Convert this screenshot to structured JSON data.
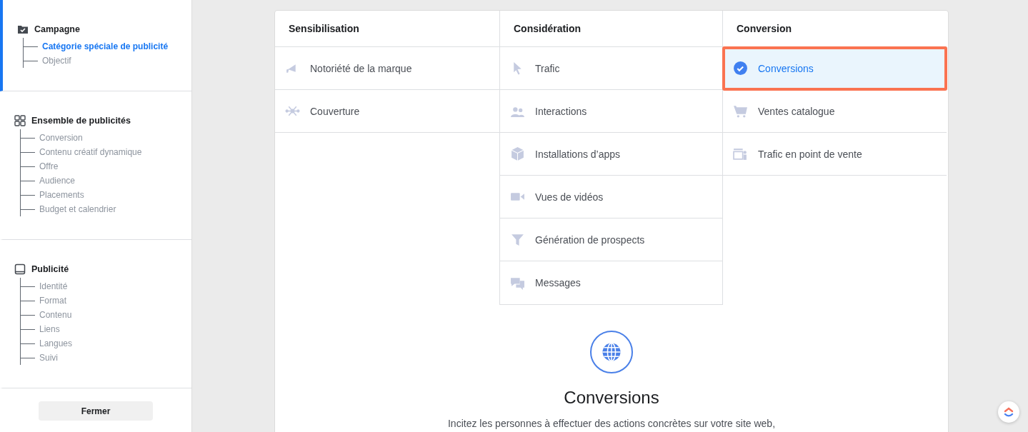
{
  "sidebar": {
    "sections": [
      {
        "title": "Campagne",
        "active": true,
        "items": [
          {
            "label": "Catégorie spéciale de publicité",
            "selected": true
          },
          {
            "label": "Objectif",
            "selected": false
          }
        ]
      },
      {
        "title": "Ensemble de publicités",
        "active": false,
        "items": [
          {
            "label": "Conversion",
            "selected": false
          },
          {
            "label": "Contenu créatif dynamique",
            "selected": false
          },
          {
            "label": "Offre",
            "selected": false
          },
          {
            "label": "Audience",
            "selected": false
          },
          {
            "label": "Placements",
            "selected": false
          },
          {
            "label": "Budget et calendrier",
            "selected": false
          }
        ]
      },
      {
        "title": "Publicité",
        "active": false,
        "items": [
          {
            "label": "Identité",
            "selected": false
          },
          {
            "label": "Format",
            "selected": false
          },
          {
            "label": "Contenu",
            "selected": false
          },
          {
            "label": "Liens",
            "selected": false
          },
          {
            "label": "Langues",
            "selected": false
          },
          {
            "label": "Suivi",
            "selected": false
          }
        ]
      }
    ],
    "close_button": "Fermer"
  },
  "objectives": {
    "columns": [
      {
        "heading": "Sensibilisation",
        "items": [
          {
            "label": "Notoriété de la marque",
            "selected": false
          },
          {
            "label": "Couverture",
            "selected": false
          }
        ]
      },
      {
        "heading": "Considération",
        "items": [
          {
            "label": "Trafic",
            "selected": false
          },
          {
            "label": "Interactions",
            "selected": false
          },
          {
            "label": "Installations d’apps",
            "selected": false
          },
          {
            "label": "Vues de vidéos",
            "selected": false
          },
          {
            "label": "Génération de prospects",
            "selected": false
          },
          {
            "label": "Messages",
            "selected": false
          }
        ]
      },
      {
        "heading": "Conversion",
        "items": [
          {
            "label": "Conversions",
            "selected": true
          },
          {
            "label": "Ventes catalogue",
            "selected": false
          },
          {
            "label": "Trafic en point de vente",
            "selected": false
          }
        ]
      }
    ]
  },
  "detail": {
    "title": "Conversions",
    "description": "Incitez les personnes à effectuer des actions concrètes sur votre site web,"
  }
}
